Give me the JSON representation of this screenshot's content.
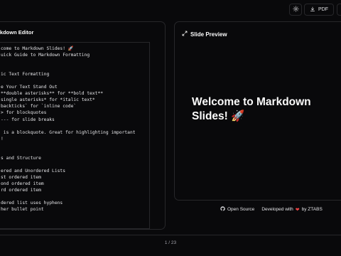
{
  "toolbar": {
    "theme_icon": "sun-icon",
    "pdf_icon": "download-icon",
    "pdf_label": "PDF"
  },
  "editor": {
    "title": "rkdown Editor",
    "lines": [
      "come to Markdown Slides! 🚀",
      "uick Guide to Markdown Formatting",
      "",
      "",
      "ic Text Formatting",
      "",
      "e Your Text Stand Out",
      "**double asterisks** for **bold text**",
      "single asterisks* for *italic text*",
      "backticks` for `inline code`",
      "> for blockquotes",
      "--- for slide breaks",
      "",
      " is a blockquote. Great for highlighting important",
      "!",
      "",
      "",
      "s and Structure",
      "",
      "ered and Unordered Lists",
      "st ordered item",
      "ond ordered item",
      "rd ordered item",
      "",
      "dered list uses hyphens",
      "her bullet point"
    ]
  },
  "preview": {
    "title": "Slide Preview",
    "expand_icon": "expand-icon",
    "slide_heading": "Welcome to Markdown Slides! 🚀"
  },
  "footer": {
    "source_label": "Open Source",
    "source_icon": "github-icon",
    "developed_prefix": "Developed with",
    "heart_icon": "heart-icon",
    "developed_suffix": "by ZTABS"
  },
  "pager": {
    "label": "1 / 23"
  },
  "colors": {
    "background": "#09090b",
    "border": "#27272a",
    "heart": "#ef4444"
  }
}
